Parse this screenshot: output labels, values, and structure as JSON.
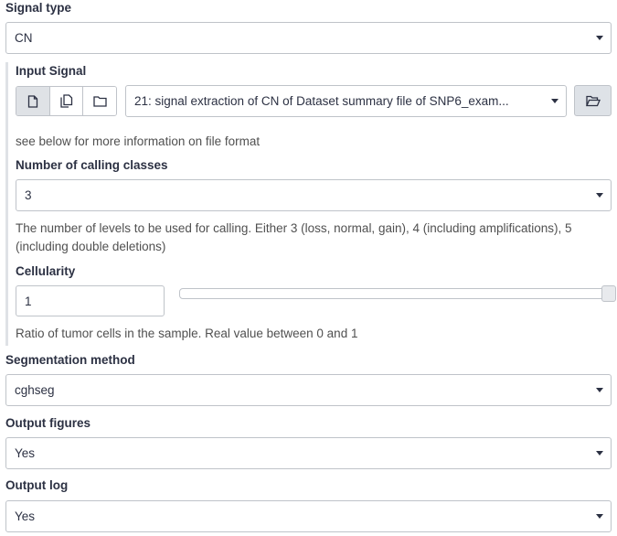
{
  "signal_type": {
    "label": "Signal type",
    "value": "CN"
  },
  "input_signal": {
    "label": "Input Signal",
    "dataset": "21: signal extraction of CN of Dataset summary file of SNP6_exam...",
    "help": "see below for more information on file format",
    "mode_icons": [
      "single-file-icon",
      "multiple-files-icon",
      "collection-folder-icon"
    ]
  },
  "calling_classes": {
    "label": "Number of calling classes",
    "value": "3",
    "help": "The number of levels to be used for calling. Either 3 (loss, normal, gain), 4 (including amplifications), 5 (including double deletions)"
  },
  "cellularity": {
    "label": "Cellularity",
    "value": "1",
    "slider_fraction": 1.0,
    "help": "Ratio of tumor cells in the sample. Real value between 0 and 1"
  },
  "segmentation_method": {
    "label": "Segmentation method",
    "value": "cghseg"
  },
  "output_figures": {
    "label": "Output figures",
    "value": "Yes"
  },
  "output_log": {
    "label": "Output log",
    "value": "Yes"
  }
}
